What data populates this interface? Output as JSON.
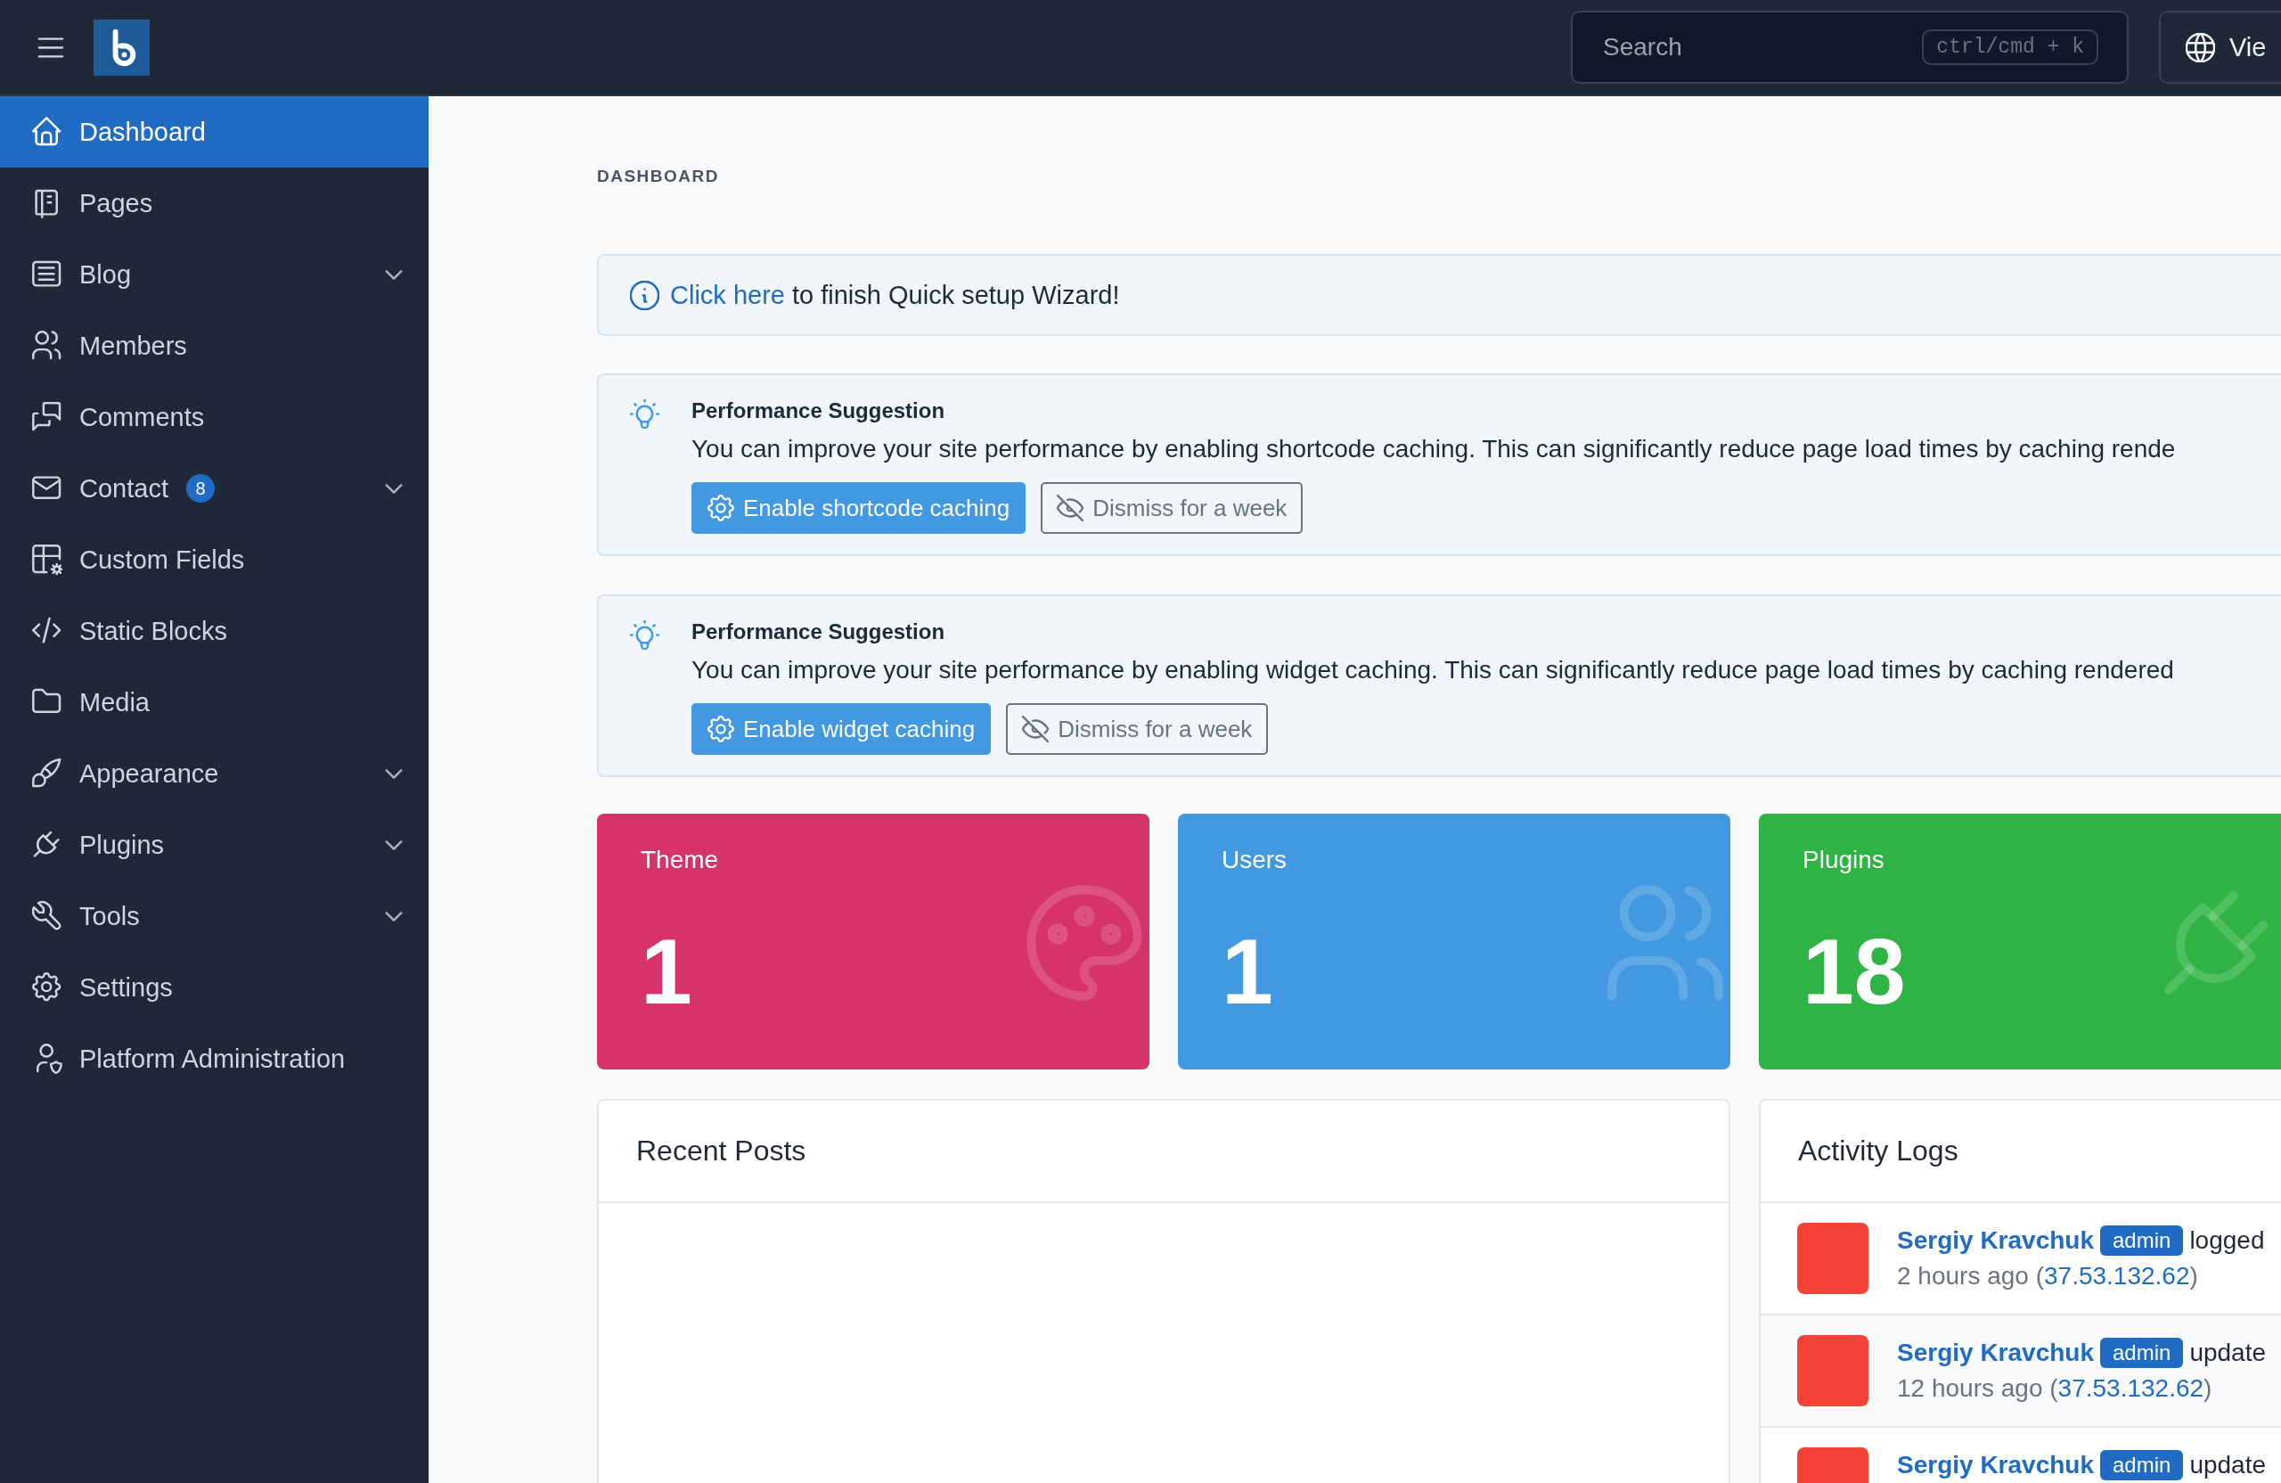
{
  "topbar": {
    "search": {
      "placeholder": "Search",
      "shortcut": "ctrl/cmd + k"
    },
    "view_button": "Vie"
  },
  "sidebar": {
    "items": [
      {
        "label": "Dashboard",
        "selected": true,
        "has_submenu": false
      },
      {
        "label": "Pages",
        "selected": false,
        "has_submenu": false
      },
      {
        "label": "Blog",
        "selected": false,
        "has_submenu": true
      },
      {
        "label": "Members",
        "selected": false,
        "has_submenu": false
      },
      {
        "label": "Comments",
        "selected": false,
        "has_submenu": false
      },
      {
        "label": "Contact",
        "selected": false,
        "has_submenu": true,
        "badge": "8"
      },
      {
        "label": "Custom Fields",
        "selected": false,
        "has_submenu": false
      },
      {
        "label": "Static Blocks",
        "selected": false,
        "has_submenu": false
      },
      {
        "label": "Media",
        "selected": false,
        "has_submenu": false
      },
      {
        "label": "Appearance",
        "selected": false,
        "has_submenu": true
      },
      {
        "label": "Plugins",
        "selected": false,
        "has_submenu": true
      },
      {
        "label": "Tools",
        "selected": false,
        "has_submenu": true
      },
      {
        "label": "Settings",
        "selected": false,
        "has_submenu": false
      },
      {
        "label": "Platform Administration",
        "selected": false,
        "has_submenu": false
      }
    ]
  },
  "breadcrumb": "DASHBOARD",
  "setup_alert": {
    "link": "Click here",
    "text": "to finish Quick setup Wizard!"
  },
  "suggestions": [
    {
      "title": "Performance Suggestion",
      "text": "You can improve your site performance by enabling shortcode caching. This can significantly reduce page load times by caching rende",
      "action": "Enable shortcode caching",
      "dismiss": "Dismiss for a week"
    },
    {
      "title": "Performance Suggestion",
      "text": "You can improve your site performance by enabling widget caching. This can significantly reduce page load times by caching rendered",
      "action": "Enable widget caching",
      "dismiss": "Dismiss for a week"
    }
  ],
  "stats": [
    {
      "label": "Theme",
      "value": "1",
      "color": "#d6336c"
    },
    {
      "label": "Users",
      "value": "1",
      "color": "#4299e1"
    },
    {
      "label": "Plugins",
      "value": "18",
      "color": "#2fb344"
    }
  ],
  "recent_posts": {
    "title": "Recent Posts"
  },
  "activity_logs": {
    "title": "Activity Logs",
    "entries": [
      {
        "user": "Sergiy Kravchuk",
        "role": "admin",
        "action": "logged",
        "time": "2 hours ago (",
        "ip": "37.53.132.62",
        "ip_close": ")"
      },
      {
        "user": "Sergiy Kravchuk",
        "role": "admin",
        "action": "update",
        "time": "12 hours ago (",
        "ip": "37.53.132.62",
        "ip_close": ")"
      },
      {
        "user": "Sergiy Kravchuk",
        "role": "admin",
        "action": "update"
      }
    ]
  }
}
